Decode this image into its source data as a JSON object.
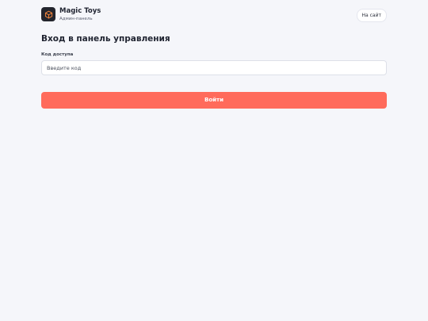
{
  "brand": {
    "name": "Magic Toys",
    "subtitle": "Админ-панель",
    "logo_icon": "cube-icon"
  },
  "header": {
    "site_link_label": "На сайт"
  },
  "login": {
    "title": "Вход в панель управления",
    "code_label": "Код доступа",
    "code_value": "",
    "code_placeholder": "Введите код",
    "submit_label": "Войти"
  },
  "colors": {
    "background": "#f5f6fa",
    "accent": "#ff6b5b",
    "logo_bg": "#23252d",
    "logo_icon": "#ff8a3d"
  }
}
